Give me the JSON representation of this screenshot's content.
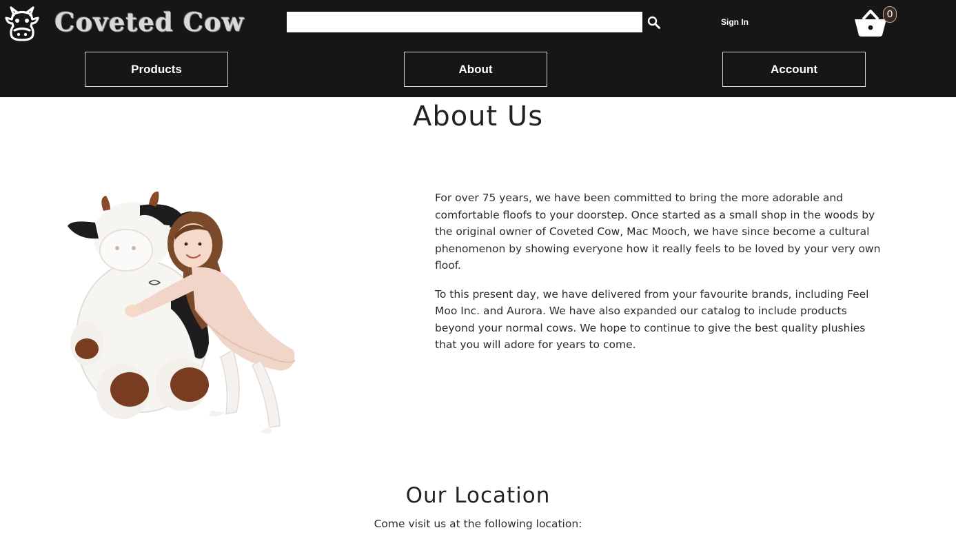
{
  "header": {
    "brand": "Coveted Cow",
    "search": {
      "value": "",
      "placeholder": ""
    },
    "sign_in_label": "Sign In",
    "cart_count": "0"
  },
  "nav": {
    "products_label": "Products",
    "about_label": "About",
    "account_label": "Account"
  },
  "about": {
    "title": "About Us",
    "paragraph1": "For over 75 years, we have been committed to bring the more adorable and comfortable floofs to your doorstep. Once started as a small shop in the woods by the original owner of Coveted Cow, Mac Mooch, we have since become a cultural phenomenon by showing everyone how it really feels to be loved by your very own floof.",
    "paragraph2": "To this present day, we have delivered from your favourite brands, including Feel Moo Inc. and Aurora. We have also expanded our catalog to include products beyond your normal cows. We hope to continue to give the best quality plushies that you will adore for years to come."
  },
  "location": {
    "title": "Our Location",
    "subtitle": "Come visit us at the following location:"
  },
  "colors": {
    "header_bg": "#161616",
    "text": "#222222",
    "nav_border": "#d6d6d6"
  }
}
